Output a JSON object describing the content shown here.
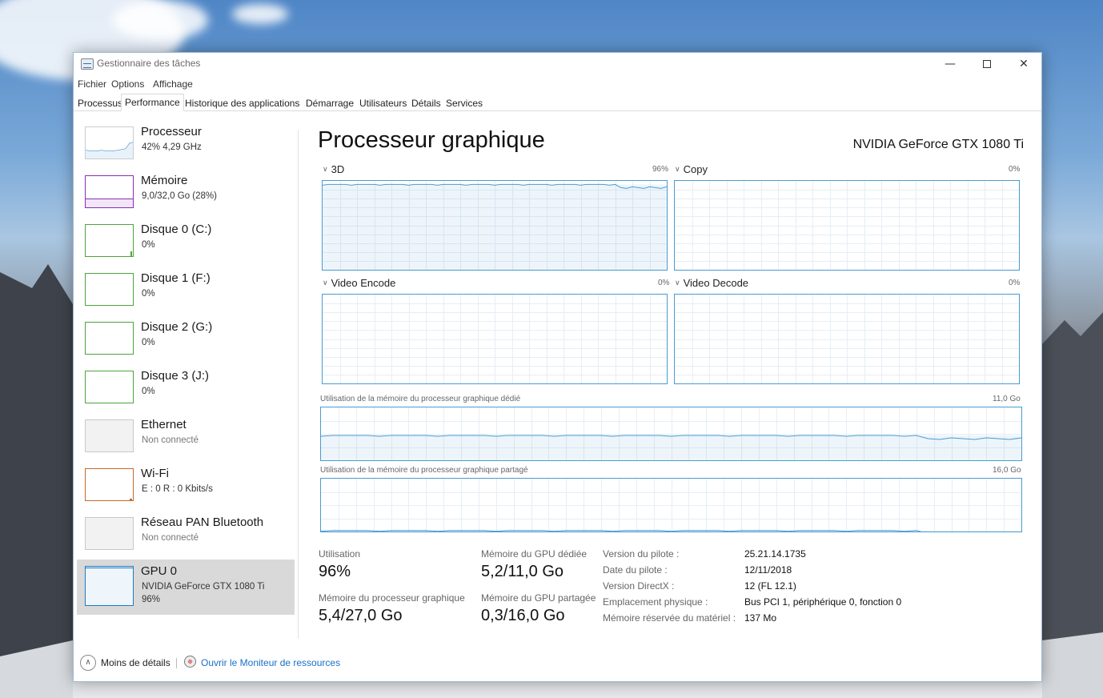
{
  "window": {
    "title": "Gestionnaire des tâches",
    "controls": {
      "minimize": "—",
      "close": "✕"
    }
  },
  "menu": [
    "Fichier",
    "Options",
    "Affichage"
  ],
  "tabs": [
    "Processus",
    "Performance",
    "Historique des applications",
    "Démarrage",
    "Utilisateurs",
    "Détails",
    "Services"
  ],
  "active_tab": "Performance",
  "sidebar": {
    "items": [
      {
        "name": "Processeur",
        "sub": "42%  4,29 GHz",
        "color": "#1f7bc1"
      },
      {
        "name": "Mémoire",
        "sub": "9,0/32,0 Go (28%)",
        "color": "#8b2fb4"
      },
      {
        "name": "Disque 0 (C:)",
        "sub": "0%",
        "color": "#4da43d"
      },
      {
        "name": "Disque 1 (F:)",
        "sub": "0%",
        "color": "#4da43d"
      },
      {
        "name": "Disque 2 (G:)",
        "sub": "0%",
        "color": "#4da43d"
      },
      {
        "name": "Disque 3 (J:)",
        "sub": "0%",
        "color": "#4da43d"
      },
      {
        "name": "Ethernet",
        "sub": "Non connecté",
        "color": "#bbbbbb"
      },
      {
        "name": "Wi-Fi",
        "sub": "E : 0  R : 0 Kbits/s",
        "color": "#c4692c"
      },
      {
        "name": "Réseau PAN Bluetooth",
        "sub": "Non connecté",
        "color": "#bbbbbb"
      },
      {
        "name": "GPU 0",
        "sub": "NVIDIA GeForce GTX 1080 Ti",
        "sub2": "96%",
        "color": "#1f7bc1"
      }
    ],
    "selected": "GPU 0"
  },
  "main": {
    "title": "Processeur graphique",
    "gpu_name": "NVIDIA GeForce GTX 1080 Ti",
    "engines": [
      {
        "label": "3D",
        "pct": "96%",
        "usage": 0.96
      },
      {
        "label": "Copy",
        "pct": "0%",
        "usage": 0
      },
      {
        "label": "Video Encode",
        "pct": "0%",
        "usage": 0
      },
      {
        "label": "Video Decode",
        "pct": "0%",
        "usage": 0
      }
    ],
    "dedicated_mem": {
      "label": "Utilisation de la mémoire du processeur graphique dédié",
      "max": "11,0 Go",
      "usage": 0.47
    },
    "shared_mem": {
      "label": "Utilisation de la mémoire du processeur graphique partagé",
      "max": "16,0 Go",
      "usage": 0.02
    },
    "graph_color": "#4a9bd1"
  },
  "stats": {
    "utilisation_label": "Utilisation",
    "utilisation_value": "96%",
    "gpu_mem_label": "Mémoire du processeur graphique",
    "gpu_mem_value": "5,4/27,0 Go",
    "dedicated_label": "Mémoire du GPU dédiée",
    "dedicated_value": "5,2/11,0 Go",
    "shared_label": "Mémoire du GPU partagée",
    "shared_value": "0,3/16,0 Go"
  },
  "info": [
    {
      "key": "Version du pilote :",
      "value": "25.21.14.1735"
    },
    {
      "key": "Date du pilote :",
      "value": "12/11/2018"
    },
    {
      "key": "Version DirectX :",
      "value": "12 (FL 12.1)"
    },
    {
      "key": "Emplacement physique :",
      "value": "Bus PCI 1, périphérique 0, fonction 0"
    },
    {
      "key": "Mémoire réservée du matériel :",
      "value": "137 Mo"
    }
  ],
  "footer": {
    "less_details": "Moins de détails",
    "open_monitor": "Ouvrir le Moniteur de ressources"
  }
}
